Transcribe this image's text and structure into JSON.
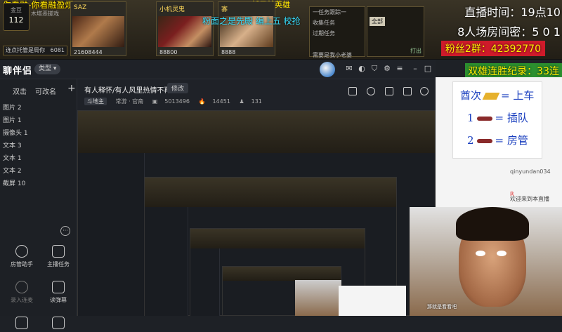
{
  "game": {
    "marquee_top": "你看融-你看融盈烦",
    "marquee_right": "新云战英雄",
    "marquee_mid": "粉面之是先殿 编上五 校抢",
    "badge_label": "金豆",
    "badge_value": "112",
    "left_label": "木塔恶搓戏",
    "button_label": "连点托管是局你",
    "button_count": "6081",
    "seats": [
      {
        "name": "SAZ",
        "gold": "21608444"
      },
      {
        "name": "小机灵鬼",
        "gold": "88800"
      },
      {
        "name": "寡",
        "gold": "8888"
      }
    ],
    "tasks": [
      "一任务跟踪一",
      "收集任务",
      "过期任务",
      "需要是我小老婆"
    ],
    "table_tab_label": "全部",
    "table_footer": "打出"
  },
  "overlay": {
    "time": "直播时间：19点10",
    "password": "8人场房间密：5 0 1",
    "fans": "粉丝2群：42392770",
    "streak": "双雄连胜纪录：33连"
  },
  "app": {
    "logo": "聊伴侣",
    "logo_tag": "类型",
    "sidebar": {
      "tab_scene": "双击",
      "tab_edit": "可改名",
      "add": "+",
      "items": [
        "图片 2",
        "图片 1",
        "摄像头 1",
        "文本 3",
        "文本 1",
        "文本 2",
        "截屏 10"
      ],
      "more": "···",
      "tools": [
        {
          "label": "房管助手"
        },
        {
          "label": "主播任务"
        },
        {
          "label": "录入连麦"
        },
        {
          "label": "读弹幕"
        },
        {
          "label": ""
        },
        {
          "label": ""
        }
      ]
    },
    "room": {
      "title": "有人释怀/有人风里热情不再",
      "edit": "修改",
      "tag": "斗地主",
      "meta1": "常游 · 官斋",
      "uid": "5013496",
      "heat": "14451",
      "viewers": "131"
    }
  },
  "chat": {
    "rules": [
      {
        "prefix": "酋次",
        "suffix": "= 上车"
      },
      {
        "prefix": "1",
        "suffix": "= 插队"
      },
      {
        "prefix": "2",
        "suffix": "= 房管"
      }
    ],
    "user": "qinyundan034",
    "welcome": "欢迎来到本直播",
    "r_label": "R"
  },
  "webcam": {
    "subtitle": "那就是看看吧"
  }
}
